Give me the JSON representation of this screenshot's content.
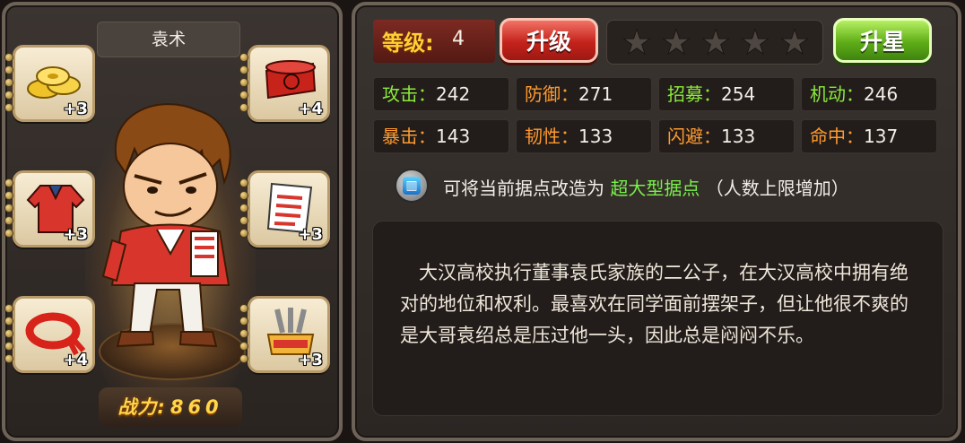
{
  "hero": {
    "name": "袁术",
    "power_label": "战力:",
    "power_value": "860"
  },
  "equipment": [
    {
      "slot": "top-left",
      "icon": "gold-coins-icon",
      "level": "+3"
    },
    {
      "slot": "top-right",
      "icon": "red-hat-icon",
      "level": "+4"
    },
    {
      "slot": "middle-left",
      "icon": "red-jacket-icon",
      "level": "+3"
    },
    {
      "slot": "middle-right",
      "icon": "scroll-paper-icon",
      "level": "+3"
    },
    {
      "slot": "bottom-left",
      "icon": "red-headband-icon",
      "level": "+4"
    },
    {
      "slot": "bottom-right",
      "icon": "school-badge-icon",
      "level": "+3"
    }
  ],
  "level": {
    "label": "等级:",
    "value": "4"
  },
  "buttons": {
    "upgrade": "升级",
    "star_up": "升星"
  },
  "stars": {
    "filled": 0,
    "total": 5
  },
  "stats": [
    {
      "name": "攻击",
      "value": "242",
      "color": "#8bea3c"
    },
    {
      "name": "防御",
      "value": "271",
      "color": "#ff9a2f"
    },
    {
      "name": "招募",
      "value": "254",
      "color": "#8bea3c"
    },
    {
      "name": "机动",
      "value": "246",
      "color": "#8bea3c"
    },
    {
      "name": "暴击",
      "value": "143",
      "color": "#ff9a2f"
    },
    {
      "name": "韧性",
      "value": "133",
      "color": "#ff9a2f"
    },
    {
      "name": "闪避",
      "value": "133",
      "color": "#ff9a2f"
    },
    {
      "name": "命中",
      "value": "137",
      "color": "#ff9a2f"
    }
  ],
  "hint": {
    "prefix": "可将当前据点改造为",
    "highlight": "超大型据点",
    "suffix": "（人数上限增加）"
  },
  "description": "大汉高校执行董事袁氏家族的二公子，在大汉高校中拥有绝对的地位和权利。最喜欢在同学面前摆架子，但让他很不爽的是大哥袁绍总是压过他一头，因此总是闷闷不乐。"
}
